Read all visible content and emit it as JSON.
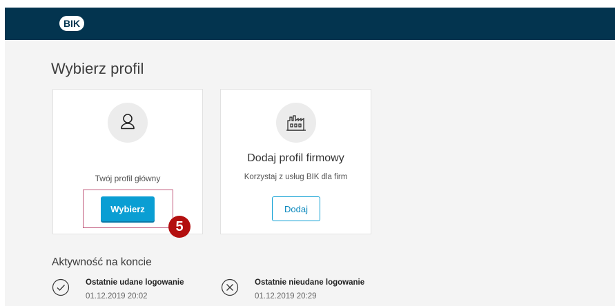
{
  "header": {
    "logo_text": "BIK",
    "colors": {
      "background": "#03344f",
      "logo": "#ffffff"
    }
  },
  "main": {
    "title": "Wybierz profil",
    "profiles": [
      {
        "icon": "user-icon",
        "label": "Twój profil główny",
        "button": "Wybierz"
      },
      {
        "icon": "factory-icon",
        "title": "Dodaj profil firmowy",
        "label": "Korzystaj z usług BIK dla firm",
        "button": "Dodaj"
      }
    ],
    "step_badge": "5"
  },
  "activity": {
    "title": "Aktywność na koncie",
    "items": [
      {
        "icon": "check-circle-icon",
        "label": "Ostatnie udane logowanie",
        "date": "01.12.2019 20:02"
      },
      {
        "icon": "x-circle-icon",
        "label": "Ostatnie nieudane logowanie",
        "date": "01.12.2019 20:29"
      }
    ]
  },
  "colors": {
    "primary": "#0a9ed3",
    "badge": "#b30f0f",
    "highlight": "#c0577a",
    "page_bg": "#f4f4f4"
  }
}
